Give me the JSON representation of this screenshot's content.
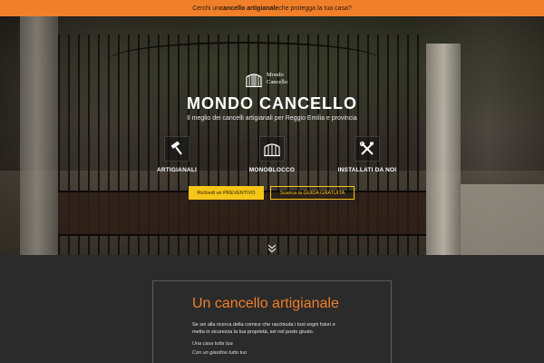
{
  "announcement": {
    "prefix": "Cerchi un ",
    "highlight": "cancello artigianale",
    "suffix": " che protegga la tua casa?"
  },
  "logo": {
    "line1": "Mondo",
    "line2": "Cancello",
    "icon": "gate-logo-icon"
  },
  "hero": {
    "title": "MONDO CANCELLO",
    "subtitle": "Il meglio dei cancelli artigianali per Reggio Emilia e provincia"
  },
  "features": [
    {
      "label": "ARTIGIANALI",
      "icon": "hammer-icon"
    },
    {
      "label": "MONOBLOCCO",
      "icon": "gate-icon"
    },
    {
      "label": "INSTALLATI DA NOI",
      "icon": "tools-icon"
    }
  ],
  "buttons": {
    "primary": "Richiedi un PREVENTIVO",
    "secondary": "Scarica la GUIDA GRATUITA"
  },
  "scroll": {
    "icon": "chevron-down-icon"
  },
  "intro": {
    "title": "Un cancello artigianale",
    "paragraph": "Se sei alla ricerca della cornice che racchiuda i tuoi sogni futuri e metta in sicurezza la tua proprietà, sei nel posto giusto.",
    "quote1": "Una casa tutta tua",
    "quote2": "Con un giardino tutto tuo"
  },
  "colors": {
    "accent_orange": "#f07f2a",
    "button_yellow": "#f5c518",
    "section_bg": "#2b2b2b"
  }
}
